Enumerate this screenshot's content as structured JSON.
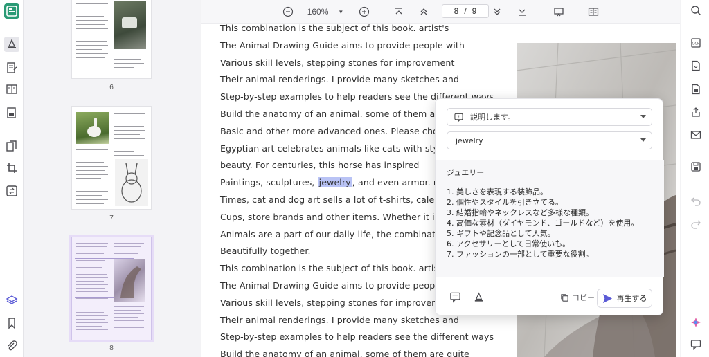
{
  "toolbar": {
    "zoom": "160%",
    "page_current": "8",
    "page_separator": "/",
    "page_total": "9"
  },
  "thumbnails": [
    {
      "label": "6"
    },
    {
      "label": "7"
    },
    {
      "label": "8"
    }
  ],
  "document": {
    "lines": [
      {
        "text": "This combination is the subject of this book. artist's"
      },
      {
        "text": "The Animal Drawing Guide aims to provide people with"
      },
      {
        "text": "Various skill levels, stepping stones for improvement"
      },
      {
        "text": "Their animal renderings. I provide many sketches and"
      },
      {
        "text": "Step-by-step examples to help readers see the different ways"
      },
      {
        "text": "Build the anatomy of an animal. some of them are qu"
      },
      {
        "text": "Basic and other more advanced ones. Please choose"
      },
      {
        "text": "Egyptian art celebrates animals like cats with style a"
      },
      {
        "text": "beauty. For centuries, this horse has inspired"
      },
      {
        "before": "Paintings, sculptures, ",
        "highlight": "jewelry",
        "after": ", and even armor. nowa"
      },
      {
        "text": "Times, cat and dog art sells a lot of t-shirts, calendar"
      },
      {
        "text": "Cups, store brands and other items. Whether it is art"
      },
      {
        "text": "Animals are a part of our daily life, the combination o"
      },
      {
        "text": "Beautifully together."
      },
      {
        "text": "This combination is the subject of this book. artist's"
      },
      {
        "text": "The Animal Drawing Guide aims to provide people wi"
      },
      {
        "text": "Various skill levels, stepping stones for improveme"
      },
      {
        "text": "Their animal renderings. I provide many sketches and"
      },
      {
        "text": "Step-by-step examples to help readers see the different ways"
      },
      {
        "text": "Build the anatomy of an animal. some of them are quite"
      }
    ]
  },
  "popup": {
    "mode": "説明します。",
    "term": "jewelry",
    "result_title": "ジュエリー",
    "result_items": [
      "1. 美しさを表現する装飾品。",
      "2. 個性やスタイルを引き立てる。",
      "3. 結婚指輪やネックレスなど多様な種類。",
      "4. 高価な素材（ダイヤモンド、ゴールドなど）を使用。",
      "5. ギフトや記念品として人気。",
      "6. アクセサリーとして日常使いも。",
      "7. ファッションの一部として重要な役割。"
    ],
    "copy_label": "コピー",
    "play_label": "再生する"
  },
  "colors": {
    "highlight": "#b9c3f5",
    "accent": "#5b5bd6",
    "logo": "#2a9a75"
  }
}
